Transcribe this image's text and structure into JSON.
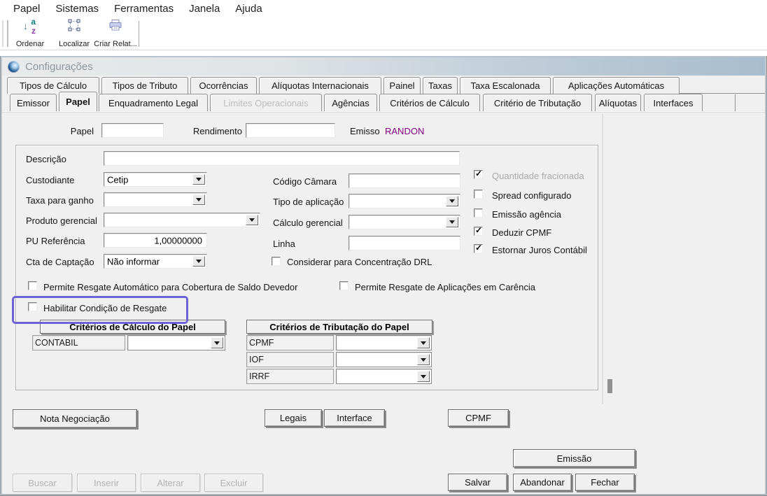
{
  "menu": {
    "items": [
      {
        "label": "Papel"
      },
      {
        "label": "Sistemas"
      },
      {
        "label": "Ferramentas"
      },
      {
        "label": "Janela"
      },
      {
        "label": "Ajuda"
      }
    ]
  },
  "toolbar": {
    "buttons": [
      {
        "label": "Ordenar",
        "icon": "sort-az-icon"
      },
      {
        "label": "Localizar",
        "icon": "marquee-selection-icon"
      },
      {
        "label": "Criar Relat...",
        "icon": "printer-report-icon"
      }
    ]
  },
  "window": {
    "title": "Configurações"
  },
  "tabs": {
    "row1": [
      {
        "label": "Tipos de Cálculo"
      },
      {
        "label": "Tipos de Tributo"
      },
      {
        "label": "Ocorrências"
      },
      {
        "label": "Alíquotas Internacionais"
      },
      {
        "label": "Painel"
      },
      {
        "label": "Taxas"
      },
      {
        "label": "Taxa Escalonada"
      },
      {
        "label": "Aplicações Automáticas"
      }
    ],
    "row2": [
      {
        "label": "Emissor"
      },
      {
        "label": "Papel",
        "active": true
      },
      {
        "label": "Enquadramento Legal"
      },
      {
        "label": "Limites Operacionais",
        "disabled": true
      },
      {
        "label": "Agências"
      },
      {
        "label": "Critérios de Cálculo"
      },
      {
        "label": "Critério de Tributação"
      },
      {
        "label": "Alíquotas"
      },
      {
        "label": "Interfaces"
      }
    ]
  },
  "header_fields": {
    "papel": {
      "label": "Papel",
      "value": ""
    },
    "rendimento": {
      "label": "Rendimento",
      "value": ""
    },
    "emissor": {
      "label": "Emisso",
      "value": "RANDON"
    }
  },
  "group": {
    "descricao": {
      "label": "Descrição",
      "value": ""
    },
    "custodiante": {
      "label": "Custodiante",
      "value": "Cetip"
    },
    "taxa_para_ganho": {
      "label": "Taxa para ganho",
      "value": ""
    },
    "produto_gerencial": {
      "label": "Produto gerencial",
      "value": ""
    },
    "pu_referencia": {
      "label": "PU Referência",
      "value": "1,00000000"
    },
    "cta_captacao": {
      "label": "Cta de Captação",
      "value": "Não informar"
    },
    "codigo_camara": {
      "label": "Código Câmara",
      "value": ""
    },
    "tipo_aplicacao": {
      "label": "Tipo de aplicação",
      "value": ""
    },
    "calculo_gerencial": {
      "label": "Cálculo gerencial",
      "value": ""
    },
    "linha": {
      "label": "Linha",
      "value": ""
    },
    "flags_right": [
      {
        "label": "Quantidade fracionada",
        "checked": true,
        "disabled": true
      },
      {
        "label": "Spread configurado",
        "checked": false
      },
      {
        "label": "Emissão agência",
        "checked": false
      },
      {
        "label": "Deduzir CPMF",
        "checked": true
      },
      {
        "label": "Estornar Juros Contábil",
        "checked": true
      }
    ],
    "considerar_drl": {
      "label": "Considerar para Concentração DRL",
      "checked": false
    },
    "permite_resgate_automatico": {
      "label": "Permite Resgate Automático para Cobertura de Saldo Devedor",
      "checked": false
    },
    "permite_resgate_carencia": {
      "label": "Permite Resgate de Aplicações em Carência",
      "checked": false
    },
    "habilitar_condicao_resgate": {
      "label": "Habilitar Condição de Resgate",
      "checked": false,
      "highlighted": true
    },
    "grid_calculo": {
      "header": "Critérios de Cálculo do Papel",
      "rows": [
        {
          "name": "CONTABIL",
          "value": ""
        }
      ]
    },
    "grid_tributacao": {
      "header": "Critérios de Tributação do Papel",
      "rows": [
        {
          "name": "CPMF",
          "value": ""
        },
        {
          "name": "IOF",
          "value": ""
        },
        {
          "name": "IRRF",
          "value": ""
        }
      ]
    }
  },
  "buttons": {
    "nota_negociacao": "Nota Negociação",
    "legais": "Legais",
    "interface": "Interface",
    "cpmf": "CPMF",
    "emissao": "Emissão",
    "buscar": "Buscar",
    "inserir": "Inserir",
    "alterar": "Alterar",
    "excluir": "Excluir",
    "salvar": "Salvar",
    "abandonar": "Abandonar",
    "fechar": "Fechar"
  },
  "colors": {
    "emissor_value": "#800080",
    "highlight_border": "#6E63D6",
    "titlebar_right": "#A8BDCE",
    "window_bg": "#F0F0F0"
  }
}
